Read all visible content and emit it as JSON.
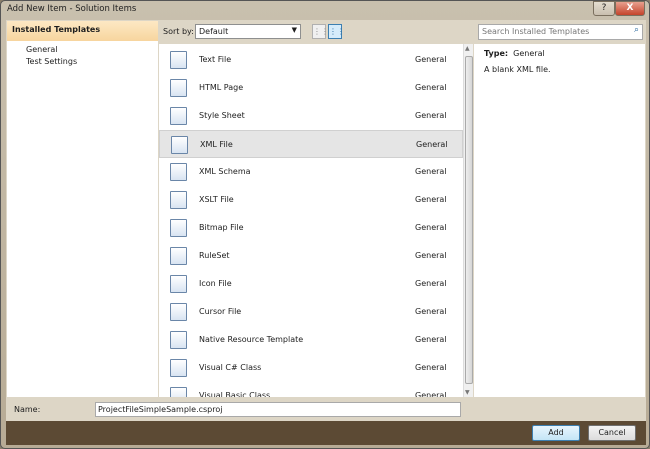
{
  "window": {
    "title": "Add New Item - Solution Items",
    "help": "?",
    "close": "X"
  },
  "left": {
    "header": "Installed Templates",
    "items": [
      "General",
      "Test Settings"
    ]
  },
  "toolbar": {
    "sort_label": "Sort by:",
    "sort_value": "Default",
    "search_placeholder": "Search Installed Templates"
  },
  "templates": [
    {
      "name": "Text File",
      "category": "General"
    },
    {
      "name": "HTML Page",
      "category": "General"
    },
    {
      "name": "Style Sheet",
      "category": "General"
    },
    {
      "name": "XML File",
      "category": "General",
      "selected": true
    },
    {
      "name": "XML Schema",
      "category": "General"
    },
    {
      "name": "XSLT File",
      "category": "General"
    },
    {
      "name": "Bitmap File",
      "category": "General"
    },
    {
      "name": "RuleSet",
      "category": "General"
    },
    {
      "name": "Icon File",
      "category": "General"
    },
    {
      "name": "Cursor File",
      "category": "General"
    },
    {
      "name": "Native Resource Template",
      "category": "General"
    },
    {
      "name": "Visual C# Class",
      "category": "General"
    },
    {
      "name": "Visual Basic Class",
      "category": "General"
    }
  ],
  "details": {
    "type_label": "Type:",
    "type_value": "General",
    "description": "A blank XML file."
  },
  "name_field": {
    "label": "Name:",
    "value": "ProjectFileSimpleSample.csproj"
  },
  "buttons": {
    "add": "Add",
    "cancel": "Cancel"
  }
}
